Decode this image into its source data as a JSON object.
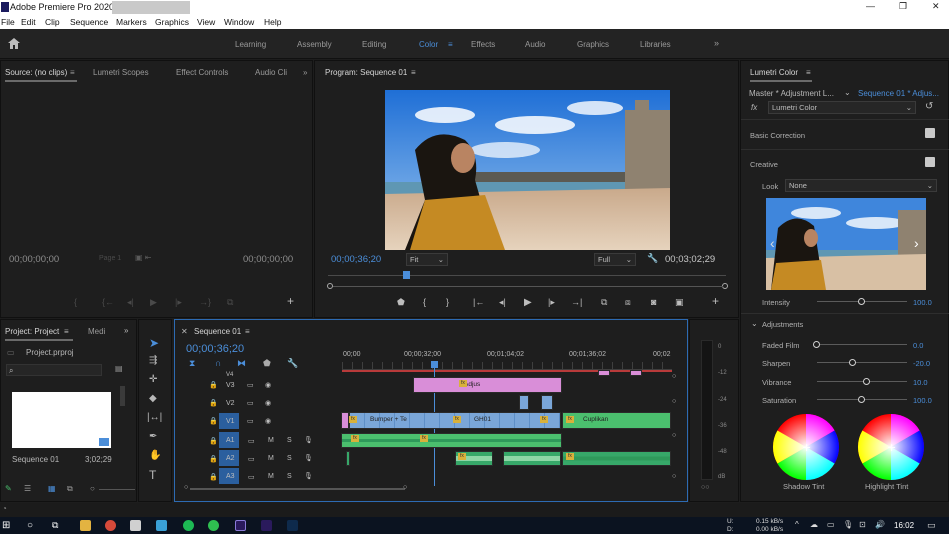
{
  "app": {
    "title": "Adobe Premiere Pro 2020 -"
  },
  "menu": [
    "File",
    "Edit",
    "Clip",
    "Sequence",
    "Markers",
    "Graphics",
    "View",
    "Window",
    "Help"
  ],
  "workspaces": [
    "Learning",
    "Assembly",
    "Editing",
    "Color",
    "Effects",
    "Audio",
    "Graphics",
    "Libraries"
  ],
  "active_workspace": "Color",
  "source_panel": {
    "tabs": [
      "Source: (no clips)",
      "Lumetri Scopes",
      "Effect Controls",
      "Audio Cli"
    ],
    "timecode_left": "00;00;00;00",
    "page": "Page 1",
    "timecode_right": "00;00;00;00"
  },
  "program_panel": {
    "title": "Program: Sequence 01",
    "timecode": "00;00;36;20",
    "zoom": "Fit",
    "quality": "Full",
    "duration": "00;03;02;29"
  },
  "lumetri": {
    "title": "Lumetri Color",
    "master": "Master * Adjustment L...",
    "sequence": "Sequence 01 * Adjus...",
    "effect": "Lumetri Color",
    "basic_correction": "Basic Correction",
    "creative": "Creative",
    "look_label": "Look",
    "look_value": "None",
    "intensity_label": "Intensity",
    "intensity_value": "100.0",
    "intensity": 1.0,
    "adjustments": "Adjustments",
    "sliders": [
      {
        "label": "Faded Film",
        "value": "0.0",
        "pos": 0.0
      },
      {
        "label": "Sharpen",
        "value": "-20.0",
        "pos": 0.4
      },
      {
        "label": "Vibrance",
        "value": "10.0",
        "pos": 0.55
      },
      {
        "label": "Saturation",
        "value": "100.0",
        "pos": 0.5
      }
    ],
    "shadow_tint": "Shadow Tint",
    "highlight_tint": "Highlight Tint"
  },
  "project_panel": {
    "tab": "Project: Project",
    "tab2": "Medi",
    "file": "Project.prproj",
    "sequence_name": "Sequence 01",
    "sequence_duration": "3;02;29"
  },
  "timeline": {
    "tab": "Sequence 01",
    "timecode": "00;00;36;20",
    "ruler": [
      "00;00",
      "00;00;32;00",
      "00;01;04;02",
      "00;01;36;02",
      "00;02"
    ],
    "tracks": [
      {
        "name": "V4"
      },
      {
        "name": "V3"
      },
      {
        "name": "V2"
      },
      {
        "name": "V1"
      },
      {
        "name": "A1"
      },
      {
        "name": "A2"
      },
      {
        "name": "A3"
      }
    ],
    "clips": {
      "adjus": "Adjus",
      "bumper": "Bumper + Te",
      "gh01": "GH01",
      "cuplikan": "Cuplikan"
    }
  },
  "meter_labels": [
    "0",
    "-12",
    "-24",
    "-36",
    "-48",
    "dB"
  ],
  "taskbar": {
    "net_up": "0.15 kB/s",
    "net_down": "0.00 kB/s",
    "net_u": "U:",
    "net_d": "D:",
    "time": "16:02"
  },
  "colors": {
    "accent": "#4b8ed9",
    "bg": "#1d1d1d",
    "panel": "#1e1e1e"
  }
}
